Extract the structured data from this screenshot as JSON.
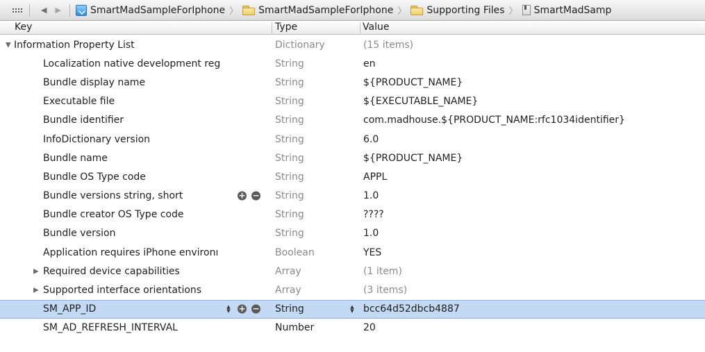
{
  "jumpbar": {
    "crumbs": [
      {
        "label": "SmartMadSampleForIphone",
        "icon": "xcode-project-icon"
      },
      {
        "label": "SmartMadSampleForIphone",
        "icon": "folder-icon"
      },
      {
        "label": "Supporting Files",
        "icon": "folder-icon"
      },
      {
        "label": "SmartMadSamp",
        "icon": "plist-file-icon"
      }
    ]
  },
  "header": {
    "key": "Key",
    "type": "Type",
    "value": "Value"
  },
  "rows": [
    {
      "key": "Information Property List",
      "type": "Dictionary",
      "value": "(15 items)"
    },
    {
      "key": "Localization native development reg",
      "type": "String",
      "value": "en"
    },
    {
      "key": "Bundle display name",
      "type": "String",
      "value": "${PRODUCT_NAME}"
    },
    {
      "key": "Executable file",
      "type": "String",
      "value": "${EXECUTABLE_NAME}"
    },
    {
      "key": "Bundle identifier",
      "type": "String",
      "value": "com.madhouse.${PRODUCT_NAME:rfc1034identifier}"
    },
    {
      "key": "InfoDictionary version",
      "type": "String",
      "value": "6.0"
    },
    {
      "key": "Bundle name",
      "type": "String",
      "value": "${PRODUCT_NAME}"
    },
    {
      "key": "Bundle OS Type code",
      "type": "String",
      "value": "APPL"
    },
    {
      "key": "Bundle versions string, short",
      "type": "String",
      "value": "1.0"
    },
    {
      "key": "Bundle creator OS Type code",
      "type": "String",
      "value": "????"
    },
    {
      "key": "Bundle version",
      "type": "String",
      "value": "1.0"
    },
    {
      "key": "Application requires iPhone environı",
      "type": "Boolean",
      "value": "YES"
    },
    {
      "key": "Required device capabilities",
      "type": "Array",
      "value": "(1 item)"
    },
    {
      "key": "Supported interface orientations",
      "type": "Array",
      "value": "(3 items)"
    },
    {
      "key": "SM_APP_ID",
      "type": "String",
      "value": "bcc64d52dbcb4887"
    },
    {
      "key": "SM_AD_REFRESH_INTERVAL",
      "type": "Number",
      "value": "20"
    }
  ],
  "controls": {
    "add_symbol": "+",
    "remove_symbol": "−",
    "expanded_triangle": "▼",
    "collapsed_triangle": "▶",
    "back_arrow": "◀",
    "forward_arrow": "▶",
    "crumb_separator": "〉",
    "stepper_up": "▲",
    "stepper_down": "▼"
  },
  "colors": {
    "selection": "#c4d9f4",
    "muted_text": "#8a8a8a"
  }
}
